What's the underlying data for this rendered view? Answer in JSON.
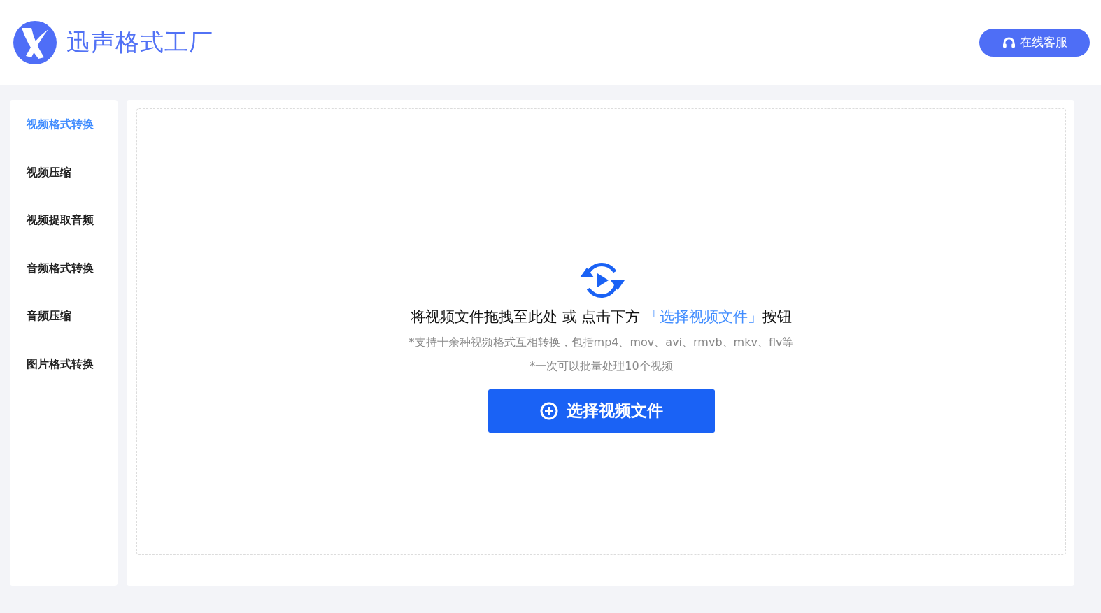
{
  "header": {
    "app_name": "迅声格式工厂",
    "support_button": "在线客服"
  },
  "sidebar": {
    "items": [
      {
        "label": "视频格式转换",
        "selected": true
      },
      {
        "label": "视频压缩",
        "selected": false
      },
      {
        "label": "视频提取音频",
        "selected": false
      },
      {
        "label": "音频格式转换",
        "selected": false
      },
      {
        "label": "音频压缩",
        "selected": false
      },
      {
        "label": "图片格式转换",
        "selected": false
      }
    ]
  },
  "dropzone": {
    "instruction_before": "将视频文件拖拽至此处 或 点击下方 ",
    "instruction_link": "「选择视频文件」",
    "instruction_after": "按钮",
    "notes": [
      "*支持十余种视频格式互相转换，包括mp4、mov、avi、rmvb、mkv、flv等",
      "*一次可以批量处理10个视频"
    ],
    "button": "选择视频文件"
  }
}
